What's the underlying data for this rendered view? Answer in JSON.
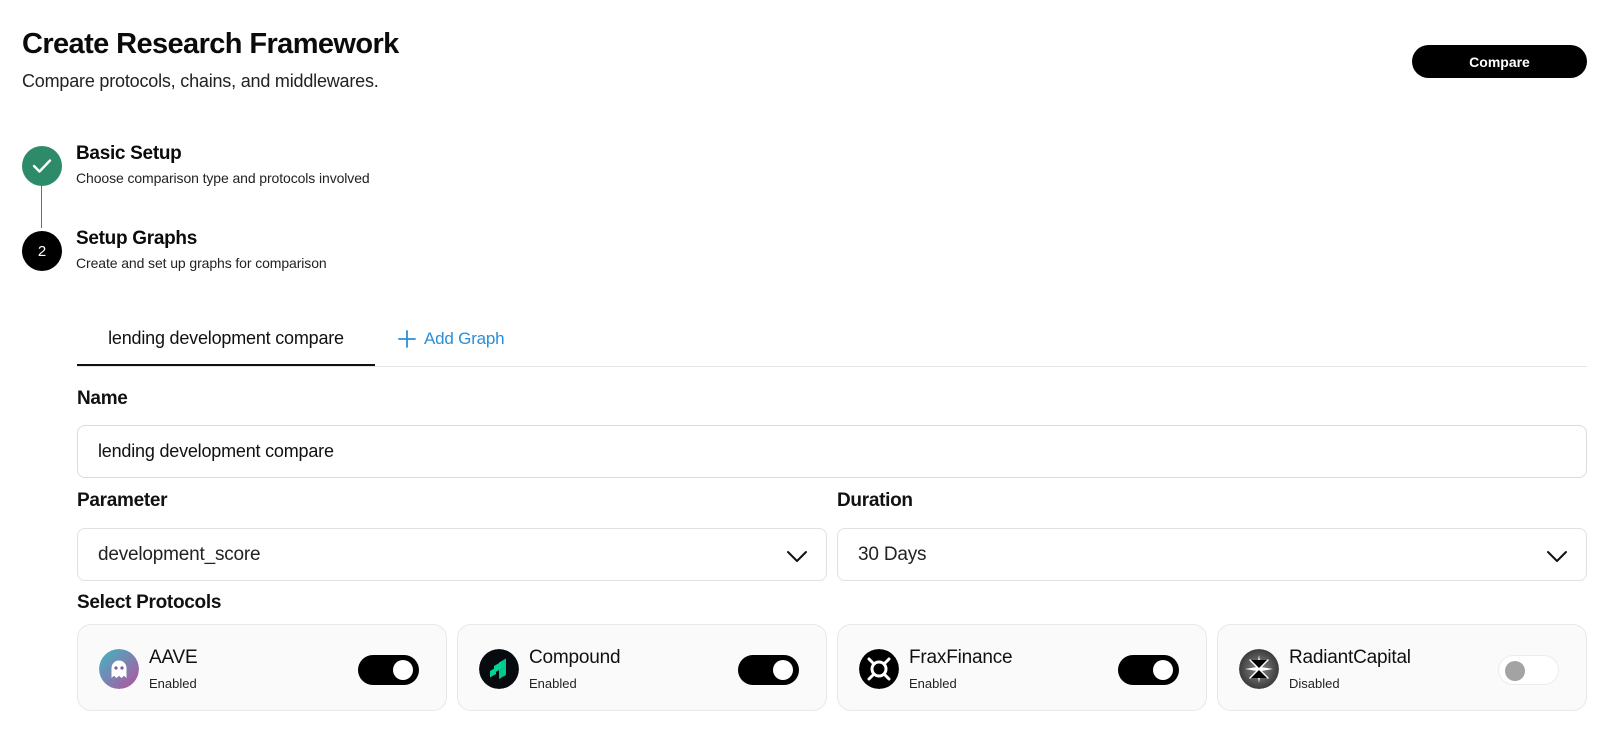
{
  "header": {
    "title": "Create Research Framework",
    "subtitle": "Compare protocols, chains, and middlewares.",
    "compare_label": "Compare"
  },
  "steps": [
    {
      "number": "1",
      "title": "Basic Setup",
      "description": "Choose comparison type and protocols involved",
      "status": "completed"
    },
    {
      "number": "2",
      "title": "Setup Graphs",
      "description": "Create and set up graphs for comparison",
      "status": "active"
    }
  ],
  "tabs": {
    "graphs": [
      {
        "label": "lending development compare",
        "active": true
      }
    ],
    "add_label": "Add Graph"
  },
  "form": {
    "name_label": "Name",
    "name_value": "lending development compare",
    "parameter_label": "Parameter",
    "parameter_value": "development_score",
    "duration_label": "Duration",
    "duration_value": "30 Days",
    "protocols_label": "Select Protocols"
  },
  "protocols": [
    {
      "name": "AAVE",
      "status": "Enabled",
      "enabled": true,
      "icon": "aave-logo-icon"
    },
    {
      "name": "Compound",
      "status": "Enabled",
      "enabled": true,
      "icon": "compound-logo-icon"
    },
    {
      "name": "FraxFinance",
      "status": "Enabled",
      "enabled": true,
      "icon": "frax-logo-icon"
    },
    {
      "name": "RadiantCapital",
      "status": "Disabled",
      "enabled": false,
      "icon": "radiant-logo-icon"
    }
  ],
  "colors": {
    "accent_green": "#2e8b6a",
    "link_blue": "#2a8fd8",
    "toggle_on": "#000000",
    "toggle_off_knob": "#a3a3a3"
  }
}
